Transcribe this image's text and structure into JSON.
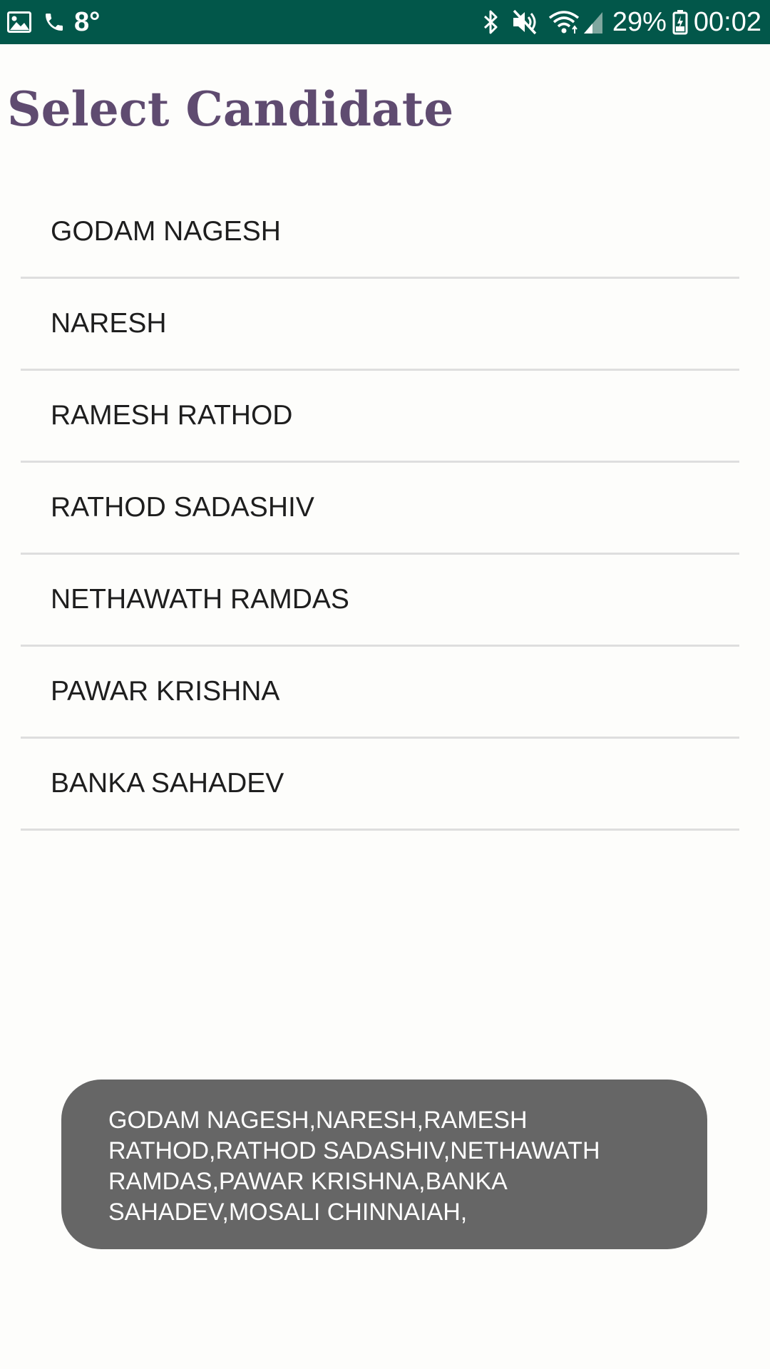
{
  "status_bar": {
    "left_icons": [
      "image-icon",
      "phone-icon"
    ],
    "temperature": "8°",
    "right_icons": [
      "bluetooth-icon",
      "mute-icon",
      "wifi-icon",
      "signal-icon",
      "battery-icon"
    ],
    "battery_percent": "29%",
    "time": "00:02",
    "background_color": "#02574a"
  },
  "page": {
    "title": "Select Candidate",
    "title_color": "#5f4b70"
  },
  "candidates": [
    "GODAM NAGESH",
    "NARESH",
    "RAMESH RATHOD",
    "RATHOD SADASHIV",
    "NETHAWATH RAMDAS",
    "PAWAR KRISHNA",
    "BANKA SAHADEV"
  ],
  "toast": {
    "message": "GODAM NAGESH,NARESH,RAMESH\nRATHOD,RATHOD SADASHIV,NETHAWATH\nRAMDAS,PAWAR KRISHNA,BANKA\nSAHADEV,MOSALI CHINNAIAH,"
  }
}
